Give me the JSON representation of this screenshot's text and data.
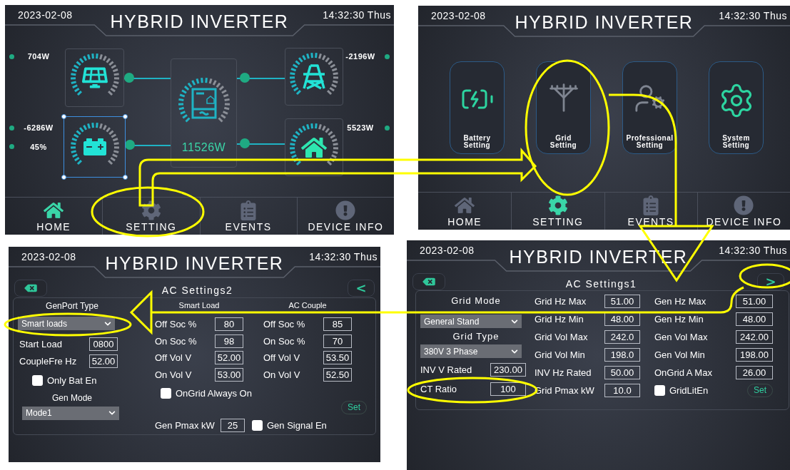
{
  "screens": [
    {
      "kind": "home",
      "date": "2023-02-08",
      "title": "HYBRID INVERTER",
      "time": "14:32:30 Thus",
      "sources": [
        {
          "kind": "solar",
          "readings": [
            "704W"
          ],
          "level": 0.55,
          "selected": false
        },
        {
          "kind": "battery",
          "readings": [
            "-6286W",
            "45%"
          ],
          "level": 0.55,
          "selected": true
        },
        {
          "kind": "grid",
          "readings": [
            "-2196W"
          ],
          "level": 0.55,
          "selected": false
        },
        {
          "kind": "load",
          "readings": [
            "5523W"
          ],
          "level": 0.55,
          "selected": false
        }
      ],
      "inverter": {
        "reading": "11526W",
        "level": 0.55
      },
      "nav": [
        {
          "kind": "home",
          "label": "HOME",
          "selected": true
        },
        {
          "kind": "setting",
          "label": "SETTING",
          "selected": false
        },
        {
          "kind": "events",
          "label": "EVENTS",
          "selected": false
        },
        {
          "kind": "info",
          "label": "DEVICE INFO",
          "selected": false
        }
      ]
    },
    {
      "kind": "menu",
      "date": "2023-02-08",
      "title": "HYBRID INVERTER",
      "time": "14:32:30 Thus",
      "tiles": [
        {
          "kind": "battery",
          "label": "Battery Setting"
        },
        {
          "kind": "grid",
          "label": "Grid Setting"
        },
        {
          "kind": "professional",
          "label": "Professional Setting"
        },
        {
          "kind": "system",
          "label": "System Setting"
        }
      ],
      "nav": [
        {
          "kind": "home",
          "label": "HOME",
          "selected": false
        },
        {
          "kind": "setting",
          "label": "SETTING",
          "selected": true
        },
        {
          "kind": "events",
          "label": "EVENTS",
          "selected": false
        },
        {
          "kind": "info",
          "label": "DEVICE INFO",
          "selected": false
        }
      ]
    },
    {
      "kind": "genport",
      "date": "2023-02-08",
      "title": "HYBRID INVERTER",
      "time": "14:32:30 Thus",
      "page_title": "AC Settings2",
      "nav_arrow": "<",
      "left": {
        "genport_label": "GenPort Type",
        "genport_select": "Smart loads",
        "fields": [
          {
            "label": "Start Load",
            "value": "0800"
          },
          {
            "label": "CoupleFre Hz",
            "value": "52.00"
          }
        ],
        "only_bat": {
          "label": "Only Bat En",
          "checked": false
        },
        "gen_mode_label": "Gen Mode",
        "gen_mode_select": "Mode1"
      },
      "columns": [
        {
          "heading": "Smart Load",
          "fields": [
            {
              "label": "Off Soc %",
              "value": "80"
            },
            {
              "label": "On Soc %",
              "value": "98"
            },
            {
              "label": "Off Vol V",
              "value": "52.00"
            },
            {
              "label": "On Vol V",
              "value": "53.00"
            }
          ]
        },
        {
          "heading": "AC Couple",
          "fields": [
            {
              "label": "Off Soc %",
              "value": "85"
            },
            {
              "label": "On Soc %",
              "value": "70"
            },
            {
              "label": "Off Vol V",
              "value": "53.50"
            },
            {
              "label": "On Vol V",
              "value": "52.50"
            }
          ]
        }
      ],
      "ongrid_always": {
        "label": "OnGrid Always On",
        "checked": false
      },
      "set_button": "Set",
      "gen_pmax": {
        "label": "Gen Pmax kW",
        "value": "25"
      },
      "gen_signal": {
        "label": "Gen Signal En",
        "checked": false
      }
    },
    {
      "kind": "gridparams",
      "date": "2023-02-08",
      "title": "HYBRID INVERTER",
      "time": "14:32:30 Thus",
      "page_title": "AC Settings1",
      "nav_arrow": ">",
      "left": {
        "selects": [
          {
            "label": "Grid Mode",
            "value": "General Stand"
          },
          {
            "label": "Grid Type",
            "value": "380V 3 Phase"
          }
        ],
        "fields": [
          {
            "label": "INV V Rated",
            "value": "230.00"
          },
          {
            "label": "CT Ratio",
            "value": "100"
          }
        ]
      },
      "grid_fields": [
        {
          "label": "Grid Hz Max",
          "value": "51.00"
        },
        {
          "label": "Grid Hz Min",
          "value": "48.00"
        },
        {
          "label": "Grid Vol Max",
          "value": "242.0"
        },
        {
          "label": "Grid Vol Min",
          "value": "198.0"
        },
        {
          "label": "INV Hz Rated",
          "value": "50.00"
        },
        {
          "label": "Grid Pmax kW",
          "value": "10.0"
        }
      ],
      "gen_fields": [
        {
          "label": "Gen Hz Max",
          "value": "51.00"
        },
        {
          "label": "Gen Hz Min",
          "value": "48.00"
        },
        {
          "label": "Gen Vol Max",
          "value": "242.00"
        },
        {
          "label": "Gen Vol Min",
          "value": "198.00"
        },
        {
          "label": "OnGrid A Max",
          "value": "26.00"
        }
      ],
      "grid_lit": {
        "label": "GridLitEn",
        "checked": false
      },
      "set_button": "Set"
    }
  ]
}
